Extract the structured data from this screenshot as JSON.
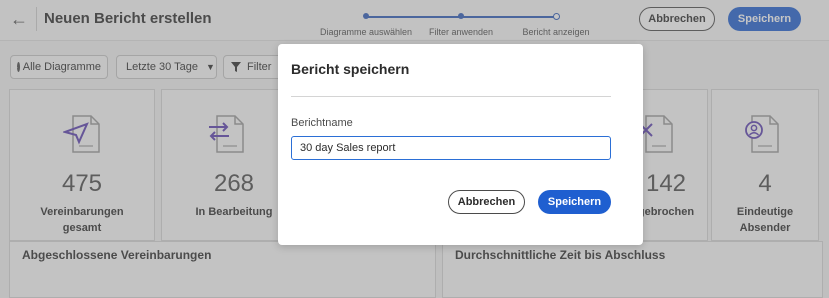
{
  "header": {
    "title": "Neuen Bericht erstellen",
    "steps": [
      "Diagramme auswählen",
      "Filter anwenden",
      "Bericht anzeigen"
    ],
    "cancel_label": "Abbrechen",
    "save_label": "Speichern"
  },
  "toolbar": {
    "all_charts_label": "Alle Diagramme",
    "range_label": "Letzte 30 Tage",
    "filter_label": "Filter"
  },
  "cards": [
    {
      "value": "475",
      "label_line1": "Vereinbarungen",
      "label_line2": "gesamt",
      "icon": "send-icon"
    },
    {
      "value": "268",
      "label_line1": "In Bearbeitung",
      "label_line2": "",
      "icon": "transfer-icon"
    },
    {
      "value": "142",
      "label_line1": "gebrochen",
      "label_line2": "",
      "icon": "cancel-icon"
    },
    {
      "value": "4",
      "label_line1": "Eindeutige",
      "label_line2": "Absender",
      "icon": "user-icon"
    }
  ],
  "panels": {
    "left_title": "Abgeschlossene Vereinbarungen",
    "right_title": "Durchschnittliche Zeit bis Abschluss"
  },
  "dialog": {
    "title": "Bericht speichern",
    "field_label": "Berichtname",
    "field_value": "30 day Sales report",
    "cancel_label": "Abbrechen",
    "save_label": "Speichern"
  },
  "colors": {
    "accent": "#1f5fd0",
    "icon": "#5a3fb0"
  }
}
